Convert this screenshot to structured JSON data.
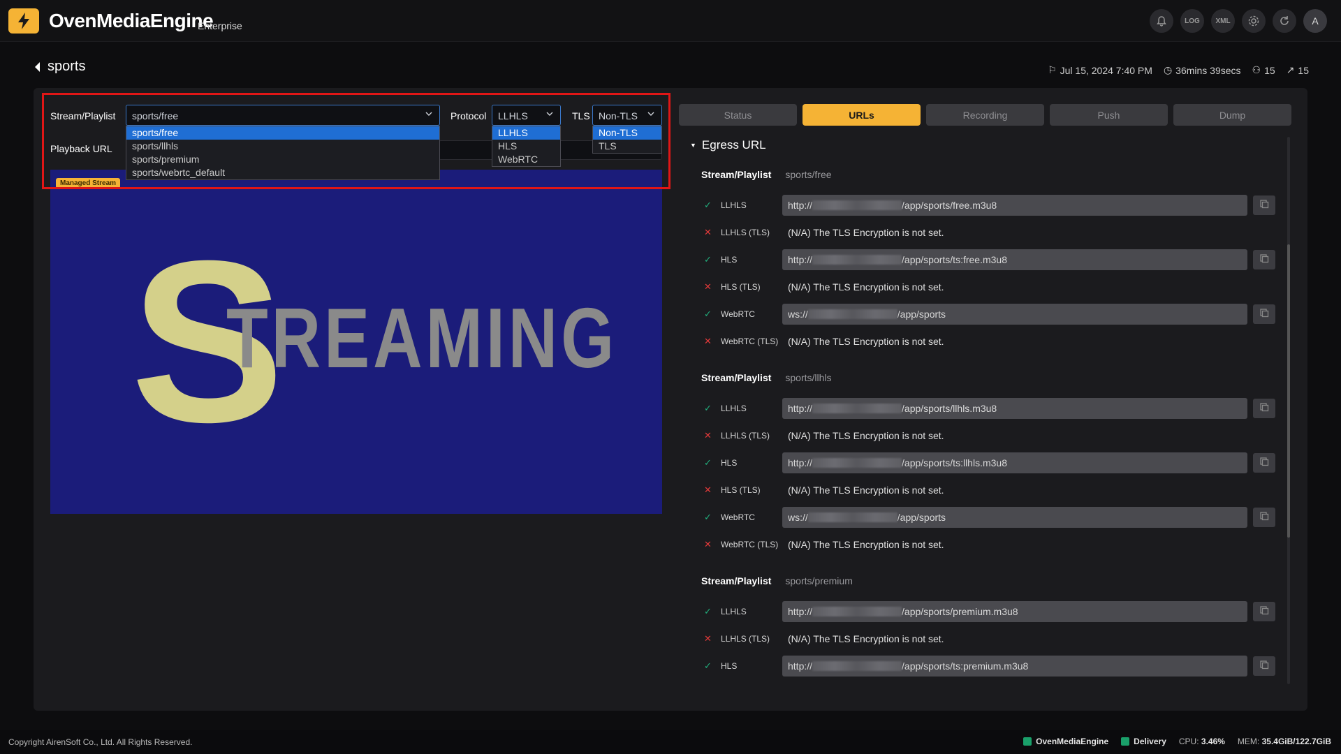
{
  "app": {
    "name": "OvenMediaEngine",
    "edition": "Enterprise"
  },
  "topbar": {
    "icons": [
      "bell-icon",
      "log-icon",
      "xml-icon",
      "gear-icon",
      "refresh-icon"
    ],
    "log_text": "LOG",
    "xml_text": "XML",
    "avatar": "A"
  },
  "page": {
    "title": "sports",
    "date": "Jul 15, 2024 7:40 PM",
    "uptime": "36mins 39secs",
    "viewers": "15",
    "peak": "15"
  },
  "player": {
    "stream_label": "Stream/Playlist",
    "stream_value": "sports/free",
    "stream_options": [
      "sports/free",
      "sports/llhls",
      "sports/premium",
      "sports/webrtc_default"
    ],
    "protocol_label": "Protocol",
    "protocol_value": "LLHLS",
    "protocol_options": [
      "LLHLS",
      "HLS",
      "WebRTC"
    ],
    "tls_label": "TLS",
    "tls_value": "Non-TLS",
    "tls_options": [
      "Non-TLS",
      "TLS"
    ],
    "playback_label": "Playback URL",
    "badge": "Managed Stream",
    "video_text_big": "S",
    "video_text": "TREAMING"
  },
  "tabs": [
    "Status",
    "URLs",
    "Recording",
    "Push",
    "Dump"
  ],
  "active_tab": "URLs",
  "egress": {
    "title": "Egress URL",
    "stream_label": "Stream/Playlist",
    "groups": [
      {
        "name": "sports/free",
        "rows": [
          {
            "proto": "LLHLS",
            "ok": "✓",
            "prefix": "http://",
            "suffix": "/app/sports/free.m3u8"
          },
          {
            "proto": "LLHLS (TLS)",
            "ok": "✕",
            "na": "(N/A) The TLS Encryption is not set."
          },
          {
            "proto": "HLS",
            "ok": "✓",
            "prefix": "http://",
            "suffix": "/app/sports/ts:free.m3u8"
          },
          {
            "proto": "HLS (TLS)",
            "ok": "✕",
            "na": "(N/A) The TLS Encryption is not set."
          },
          {
            "proto": "WebRTC",
            "ok": "✓",
            "prefix": "ws://",
            "suffix": "/app/sports"
          },
          {
            "proto": "WebRTC (TLS)",
            "ok": "✕",
            "na": "(N/A) The TLS Encryption is not set."
          }
        ]
      },
      {
        "name": "sports/llhls",
        "rows": [
          {
            "proto": "LLHLS",
            "ok": "✓",
            "prefix": "http://",
            "suffix": "/app/sports/llhls.m3u8"
          },
          {
            "proto": "LLHLS (TLS)",
            "ok": "✕",
            "na": "(N/A) The TLS Encryption is not set."
          },
          {
            "proto": "HLS",
            "ok": "✓",
            "prefix": "http://",
            "suffix": "/app/sports/ts:llhls.m3u8"
          },
          {
            "proto": "HLS (TLS)",
            "ok": "✕",
            "na": "(N/A) The TLS Encryption is not set."
          },
          {
            "proto": "WebRTC",
            "ok": "✓",
            "prefix": "ws://",
            "suffix": "/app/sports"
          },
          {
            "proto": "WebRTC (TLS)",
            "ok": "✕",
            "na": "(N/A) The TLS Encryption is not set."
          }
        ]
      },
      {
        "name": "sports/premium",
        "rows": [
          {
            "proto": "LLHLS",
            "ok": "✓",
            "prefix": "http://",
            "suffix": "/app/sports/premium.m3u8"
          },
          {
            "proto": "LLHLS (TLS)",
            "ok": "✕",
            "na": "(N/A) The TLS Encryption is not set."
          },
          {
            "proto": "HLS",
            "ok": "✓",
            "prefix": "http://",
            "suffix": "/app/sports/ts:premium.m3u8"
          }
        ]
      }
    ]
  },
  "footer": {
    "copyright": "Copyright AirenSoft Co., Ltd. All Rights Reserved.",
    "engine": "OvenMediaEngine",
    "delivery": "Delivery",
    "cpu_label": "CPU:",
    "cpu": "3.46%",
    "mem_label": "MEM:",
    "mem": "35.4GiB/122.7GiB"
  },
  "colors": {
    "accent": "#f5b335",
    "ok": "#22b07d",
    "error": "#e23a3a",
    "highlight": "#e01616",
    "video_bg": "#1b1c7a"
  }
}
